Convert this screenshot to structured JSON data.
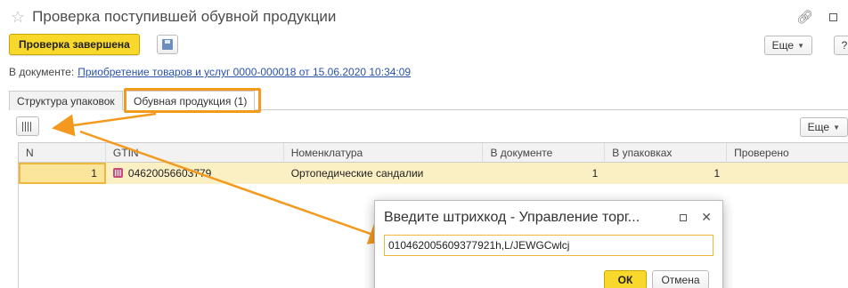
{
  "header": {
    "title": "Проверка поступившей обувной продукции"
  },
  "toolbar": {
    "done_label": "Проверка завершена",
    "more_label": "Еще",
    "help_label": "?"
  },
  "document": {
    "prefix": "В документе:",
    "link": "Приобретение товаров и услуг 0000-000018 от 15.06.2020 10:34:09"
  },
  "tabs": [
    {
      "label": "Структура упаковок"
    },
    {
      "label": "Обувная продукция (1)"
    }
  ],
  "subtoolbar": {
    "more_label": "Еще"
  },
  "table": {
    "columns": [
      "N",
      "GTIN",
      "Номенклатура",
      "В документе",
      "В упаковках",
      "Проверено"
    ],
    "rows": [
      {
        "n": "1",
        "gtin": "04620056603779",
        "item": "Ортопедические сандалии",
        "in_doc": "1",
        "in_packs": "1",
        "checked": ""
      }
    ]
  },
  "dialog": {
    "title": "Введите штрихкод - Управление торг...",
    "input_value": "010462005609377921h,L/JEWGCwlcj",
    "ok_label": "ОК",
    "cancel_label": "Отмена"
  },
  "colors": {
    "accent_yellow": "#f8d82a",
    "highlight_orange": "#f39a1e",
    "row_selected": "#fbf0c4",
    "link_blue": "#2a52a8"
  }
}
